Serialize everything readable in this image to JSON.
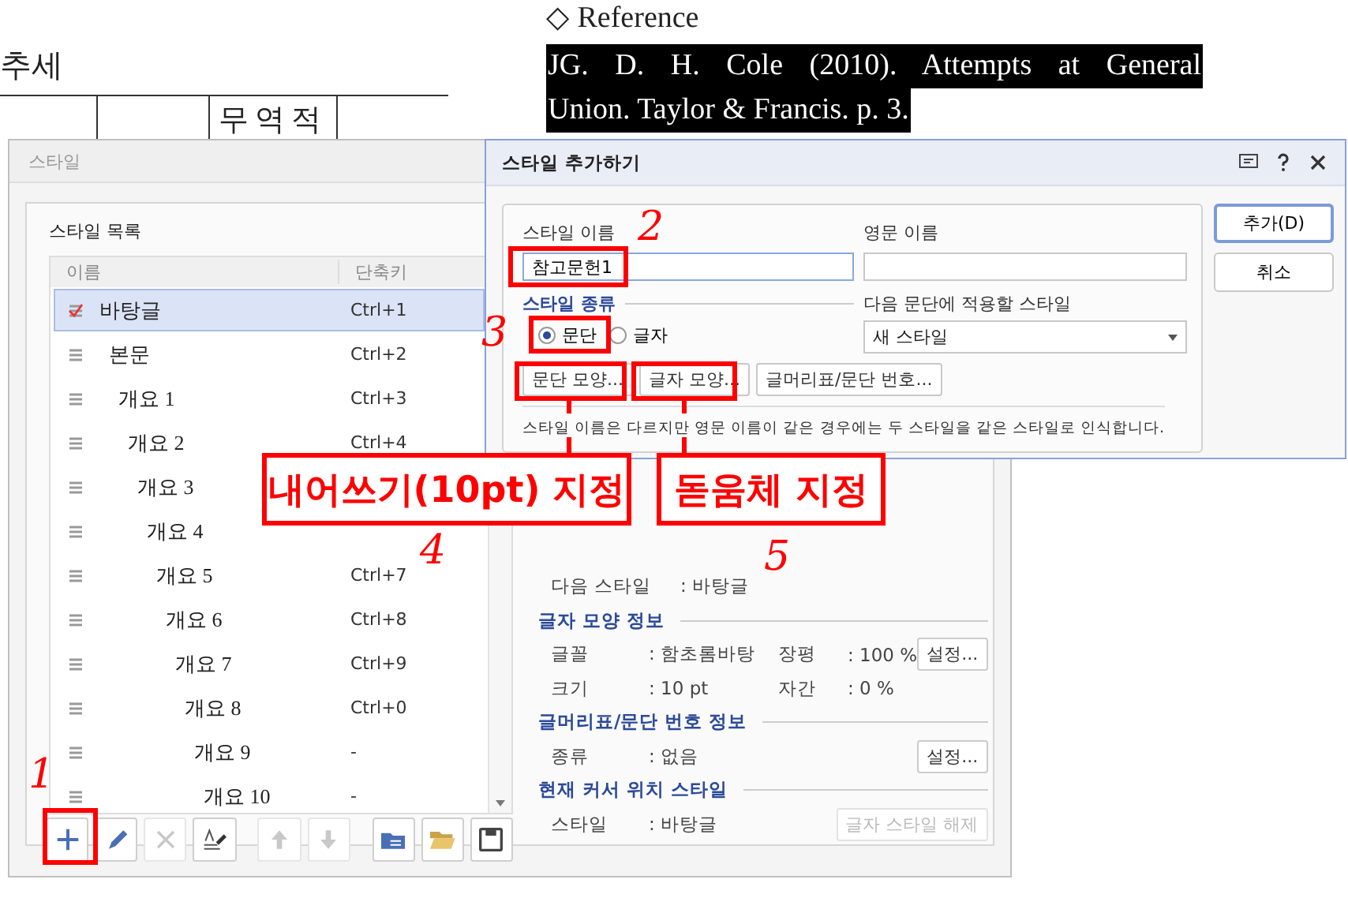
{
  "document": {
    "heading": "추세",
    "table_header": "무역적",
    "reference_title": "◇ Reference",
    "reference_lines": [
      "JG. D. H. Cole (2010). Attempts at General",
      "Union. Taylor & Francis. p. 3."
    ]
  },
  "styles_dialog": {
    "title": "스타일",
    "list_label": "스타일 목록",
    "columns": [
      "이름",
      "단축키"
    ],
    "items": [
      {
        "name": "바탕글",
        "shortcut": "Ctrl+1",
        "selected": true
      },
      {
        "name": "본문",
        "shortcut": "Ctrl+2",
        "selected": false
      },
      {
        "name": "개요 1",
        "shortcut": "Ctrl+3",
        "selected": false
      },
      {
        "name": "개요 2",
        "shortcut": "Ctrl+4",
        "selected": false
      },
      {
        "name": "개요 3",
        "selected": false
      },
      {
        "name": "개요 4",
        "selected": false
      },
      {
        "name": "개요 5",
        "shortcut": "Ctrl+7",
        "selected": false
      },
      {
        "name": "개요 6",
        "shortcut": "Ctrl+8",
        "selected": false
      },
      {
        "name": "개요 7",
        "shortcut": "Ctrl+9",
        "selected": false
      },
      {
        "name": "개요 8",
        "shortcut": "Ctrl+0",
        "selected": false
      },
      {
        "name": "개요 9",
        "shortcut": "-",
        "selected": false
      },
      {
        "name": "개요 10",
        "shortcut": "-",
        "selected": false
      }
    ],
    "toolbar": [
      {
        "kind": "add",
        "disabled": false
      },
      {
        "kind": "edit",
        "disabled": false
      },
      {
        "kind": "delete",
        "disabled": true
      },
      {
        "kind": "picker",
        "disabled": false
      },
      {
        "kind": "up",
        "disabled": true
      },
      {
        "kind": "down",
        "disabled": true
      },
      {
        "kind": "import",
        "disabled": false
      },
      {
        "kind": "open",
        "disabled": false
      },
      {
        "kind": "save",
        "disabled": false
      }
    ],
    "next_style": {
      "label": "다음 스타일",
      "value": ": 바탕글"
    },
    "sections": [
      {
        "title": "글자 모양 정보",
        "rows": [
          {
            "label": "글꼴",
            "value": ": 함초롬바탕",
            "label2": "장평",
            "value2": ": 100 %"
          },
          {
            "label": "크기",
            "value": ": 10 pt",
            "label2": "자간",
            "value2": ": 0 %"
          }
        ],
        "button": {
          "label": "설정...",
          "disabled": false
        }
      },
      {
        "title": "글머리표/문단 번호 정보",
        "rows": [
          {
            "label": "종류",
            "value": ": 없음"
          }
        ],
        "button": {
          "label": "설정...",
          "disabled": false
        }
      },
      {
        "title": "현재 커서 위치 스타일",
        "rows": [
          {
            "label": "스타일",
            "value": ": 바탕글"
          }
        ],
        "button": {
          "label": "글자 스타일 해제",
          "disabled": true
        }
      }
    ]
  },
  "add_dialog": {
    "title": "스타일 추가하기",
    "name_label": "스타일 이름",
    "name_value": "참고문헌1",
    "english_label": "영문 이름",
    "type_label": "스타일 종류",
    "type_options": [
      {
        "label": "문단",
        "selected": true
      },
      {
        "label": "글자",
        "selected": false
      }
    ],
    "next_label": "다음 문단에 적용할 스타일",
    "next_value": "새 스타일",
    "buttons": [
      "문단 모양...",
      "글자 모양...",
      "글머리표/문단 번호..."
    ],
    "note": "스타일 이름은 다르지만 영문 이름이 같은 경우에는 두 스타일을 같은 스타일로 인식합니다.",
    "actions": [
      "추가(D)",
      "취소"
    ]
  },
  "annotations": {
    "callouts": [
      "내어쓰기(10pt) 지정",
      "돋움체 지정"
    ],
    "numbers": [
      "1",
      "2",
      "3",
      "4",
      "5"
    ]
  }
}
